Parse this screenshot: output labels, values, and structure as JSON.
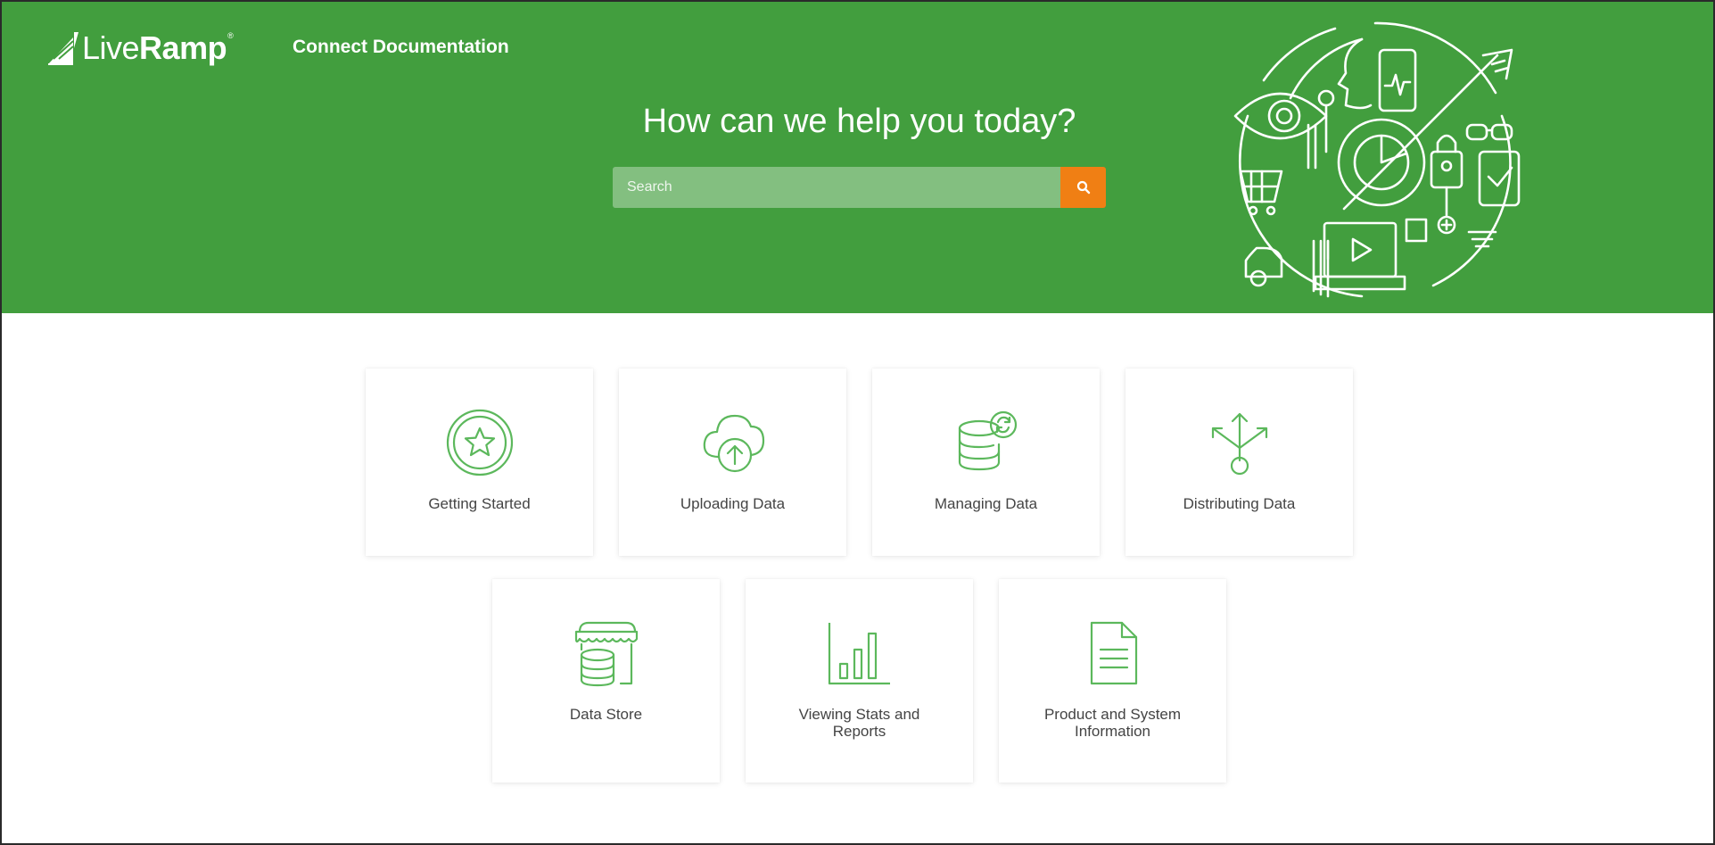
{
  "header": {
    "logo": {
      "text_live": "Live",
      "text_ramp": "Ramp",
      "reg": "®"
    },
    "doc_title": "Connect Documentation",
    "heading": "How can we help you today?",
    "search": {
      "placeholder": "Search",
      "value": "",
      "button_icon": "search-icon"
    },
    "illustration": "line-art-circle-illustration"
  },
  "cards": {
    "row1": [
      {
        "label": "Getting Started",
        "icon": "star-badge-icon"
      },
      {
        "label": "Uploading Data",
        "icon": "cloud-upload-icon"
      },
      {
        "label": "Managing Data",
        "icon": "database-sync-icon"
      },
      {
        "label": "Distributing Data",
        "icon": "distribute-arrows-icon"
      }
    ],
    "row2": [
      {
        "label": "Data Store",
        "icon": "storefront-database-icon"
      },
      {
        "label": "Viewing Stats and Reports",
        "icon": "bar-chart-icon"
      },
      {
        "label": "Product and System Information",
        "icon": "document-icon"
      }
    ]
  },
  "colors": {
    "brand_green": "#429e3e",
    "search_field": "#83bf80",
    "search_button": "#f07f14",
    "icon_green": "#5cb85c",
    "card_text": "#444444"
  }
}
